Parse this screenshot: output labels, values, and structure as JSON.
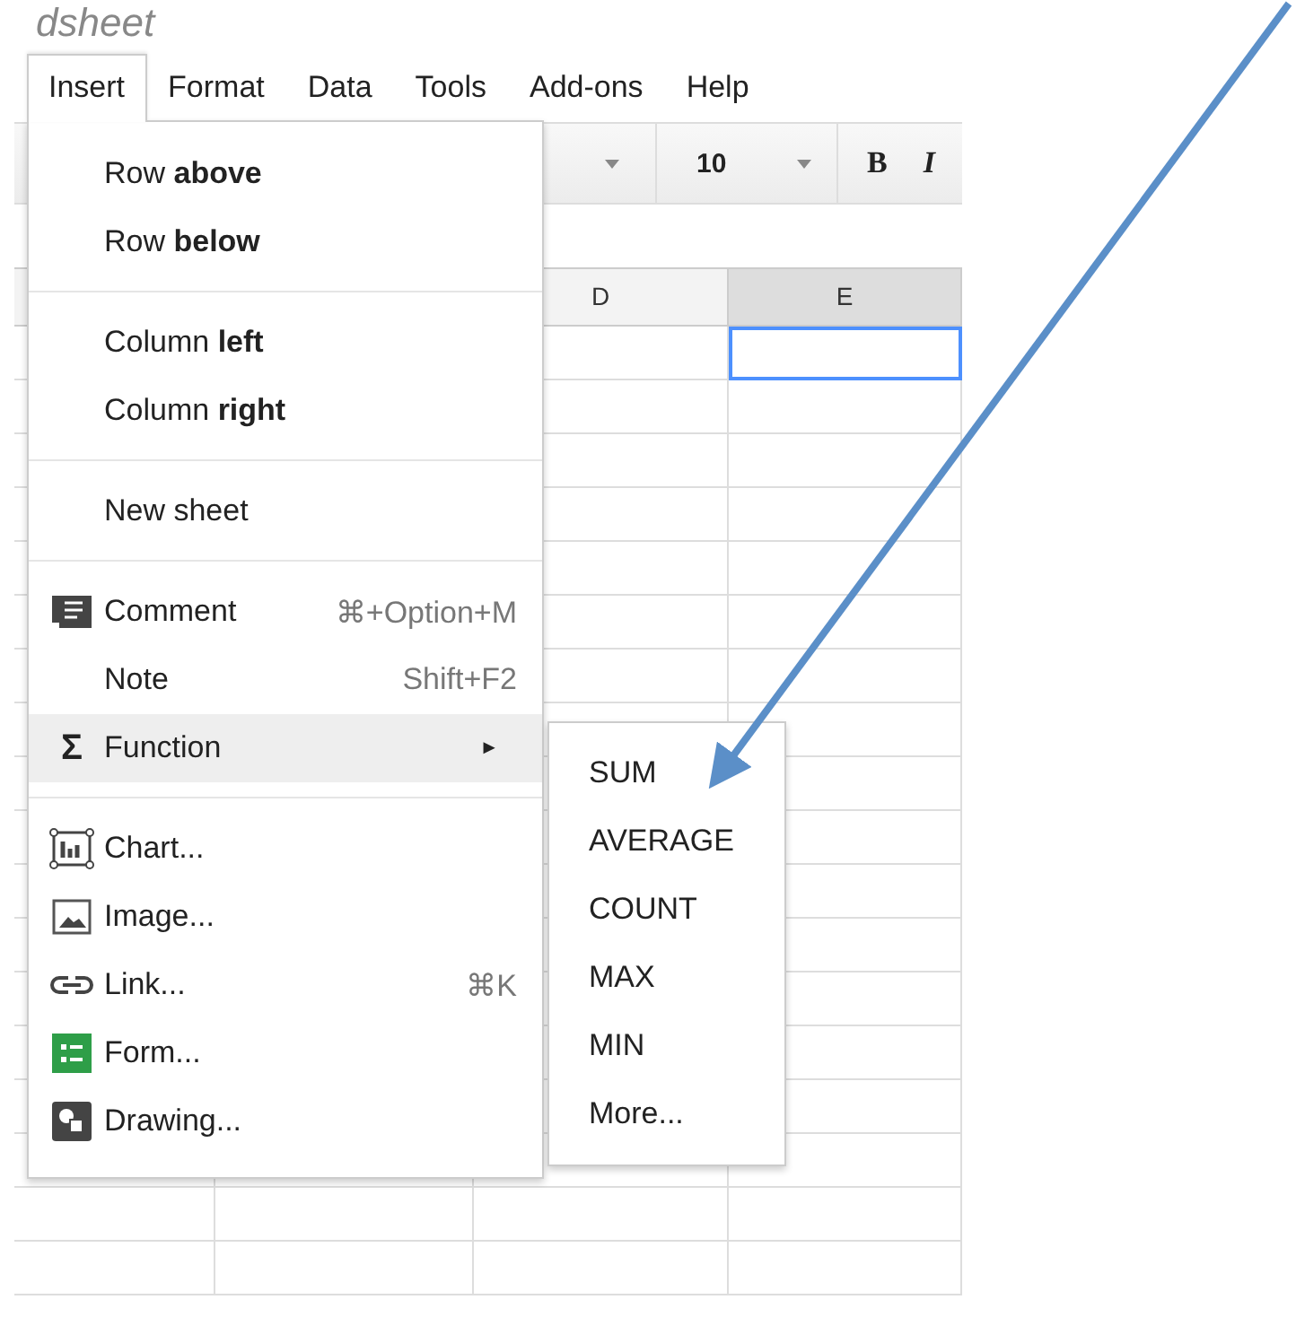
{
  "title_fragment": "dsheet",
  "menubar": [
    {
      "label": "Insert",
      "selected": true
    },
    {
      "label": "Format",
      "selected": false
    },
    {
      "label": "Data",
      "selected": false
    },
    {
      "label": "Tools",
      "selected": false
    },
    {
      "label": "Add-ons",
      "selected": false
    },
    {
      "label": "Help",
      "selected": false
    }
  ],
  "toolbar": {
    "font_size": "10",
    "bold": "B",
    "italic": "I"
  },
  "columns": [
    {
      "label": "D",
      "selected": false
    },
    {
      "label": "E",
      "selected": true
    }
  ],
  "menu": [
    {
      "kind": "item",
      "text": "Row **above**",
      "selected": false
    },
    {
      "kind": "item",
      "text": "Row **below**",
      "selected": false
    },
    {
      "kind": "separator"
    },
    {
      "kind": "item",
      "text": "Column **left**",
      "selected": false
    },
    {
      "kind": "item",
      "text": "Column **right**",
      "selected": false
    },
    {
      "kind": "separator"
    },
    {
      "kind": "item",
      "text": "New sheet",
      "selected": false
    },
    {
      "kind": "separator"
    },
    {
      "kind": "item",
      "text": "Comment",
      "shortcut": "⌘+Option+M",
      "selected": false
    },
    {
      "kind": "item",
      "text": "Note",
      "shortcut": "Shift+F2",
      "selected": false
    },
    {
      "kind": "submenu",
      "text": "Function",
      "arrow": "►",
      "sigma": "Σ",
      "selected": true
    },
    {
      "kind": "separator"
    },
    {
      "kind": "item",
      "text": "Chart...",
      "selected": false
    },
    {
      "kind": "item",
      "text": "Image...",
      "selected": false
    },
    {
      "kind": "item",
      "text": "Link...",
      "shortcut": "⌘K",
      "selected": false
    },
    {
      "kind": "item",
      "text": "Form...",
      "selected": false
    },
    {
      "kind": "item",
      "text": "Drawing...",
      "selected": false
    }
  ],
  "submenu": [
    "SUM",
    "AVERAGE",
    "COUNT",
    "MAX",
    "MIN",
    "More..."
  ]
}
